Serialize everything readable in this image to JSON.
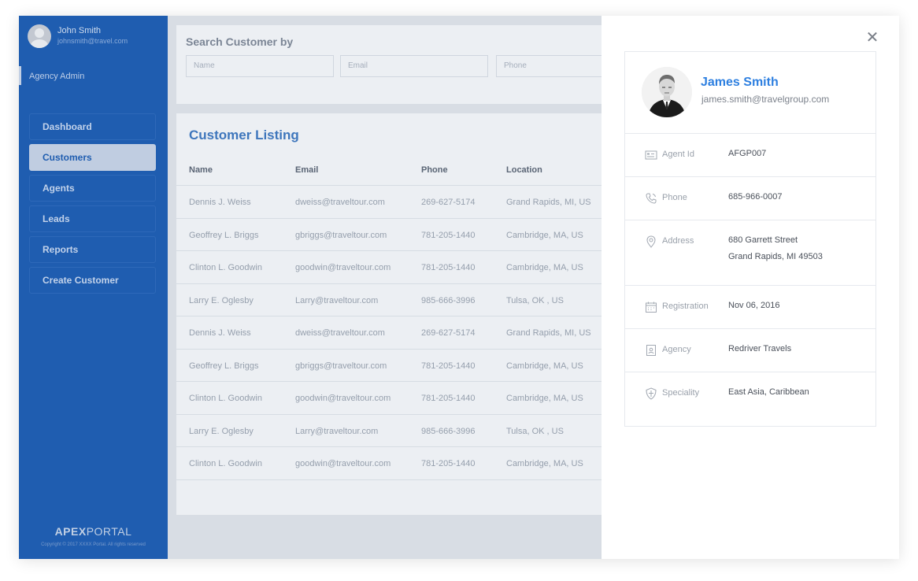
{
  "sidebar": {
    "user_name": "John Smith",
    "user_email": "johnsmith@travel.com",
    "role": "Agency Admin",
    "nav": [
      {
        "label": "Dashboard",
        "active": false
      },
      {
        "label": "Customers",
        "active": true
      },
      {
        "label": "Agents",
        "active": false
      },
      {
        "label": "Leads",
        "active": false
      },
      {
        "label": "Reports",
        "active": false
      },
      {
        "label": "Create Customer",
        "active": false
      }
    ],
    "brand_bold": "APEX",
    "brand_light": "PORTAL",
    "copyright": "Copyright © 2017 XXXX Portal. All rights reserved"
  },
  "search": {
    "title": "Search Customer by",
    "name_placeholder": "Name",
    "email_placeholder": "Email",
    "phone_placeholder": "Phone"
  },
  "listing": {
    "title": "Customer Listing",
    "columns": [
      "Name",
      "Email",
      "Phone",
      "Location"
    ],
    "rows": [
      [
        "Dennis J. Weiss",
        "dweiss@traveltour.com",
        "269-627-5174",
        "Grand Rapids, MI, US"
      ],
      [
        "Geoffrey L. Briggs",
        "gbriggs@traveltour.com",
        "781-205-1440",
        "Cambridge, MA, US"
      ],
      [
        "Clinton L. Goodwin",
        "goodwin@traveltour.com",
        "781-205-1440",
        "Cambridge, MA, US"
      ],
      [
        "Larry E. Oglesby",
        "Larry@traveltour.com",
        "985-666-3996",
        "Tulsa, OK , US"
      ],
      [
        "Dennis J. Weiss",
        "dweiss@traveltour.com",
        "269-627-5174",
        "Grand Rapids, MI, US"
      ],
      [
        "Geoffrey L. Briggs",
        "gbriggs@traveltour.com",
        "781-205-1440",
        "Cambridge, MA, US"
      ],
      [
        "Clinton L. Goodwin",
        "goodwin@traveltour.com",
        "781-205-1440",
        "Cambridge, MA, US"
      ],
      [
        "Larry E. Oglesby",
        "Larry@traveltour.com",
        "985-666-3996",
        "Tulsa, OK , US"
      ],
      [
        "Clinton L. Goodwin",
        "goodwin@traveltour.com",
        "781-205-1440",
        "Cambridge, MA, US"
      ]
    ]
  },
  "detail": {
    "close_icon": "close-icon",
    "name": "James Smith",
    "email": "james.smith@travelgroup.com",
    "fields": [
      {
        "icon": "id-card-icon",
        "label": "Agent Id",
        "value": "AFGP007"
      },
      {
        "icon": "phone-icon",
        "label": "Phone",
        "value": "685-966-0007"
      },
      {
        "icon": "location-pin-icon",
        "label": "Address",
        "value": "680 Garrett Street",
        "value2": "Grand Rapids, MI 49503"
      },
      {
        "icon": "calendar-icon",
        "label": "Registration",
        "value": "Nov 06, 2016"
      },
      {
        "icon": "agency-badge-icon",
        "label": "Agency",
        "value": "Redriver Travels"
      },
      {
        "icon": "shield-icon",
        "label": "Speciality",
        "value": "East Asia, Caribbean"
      }
    ]
  },
  "colors": {
    "sidebar_bg": "#1f5eb3",
    "accent": "#2d7fe0",
    "content_bg": "#dfe3ea"
  }
}
